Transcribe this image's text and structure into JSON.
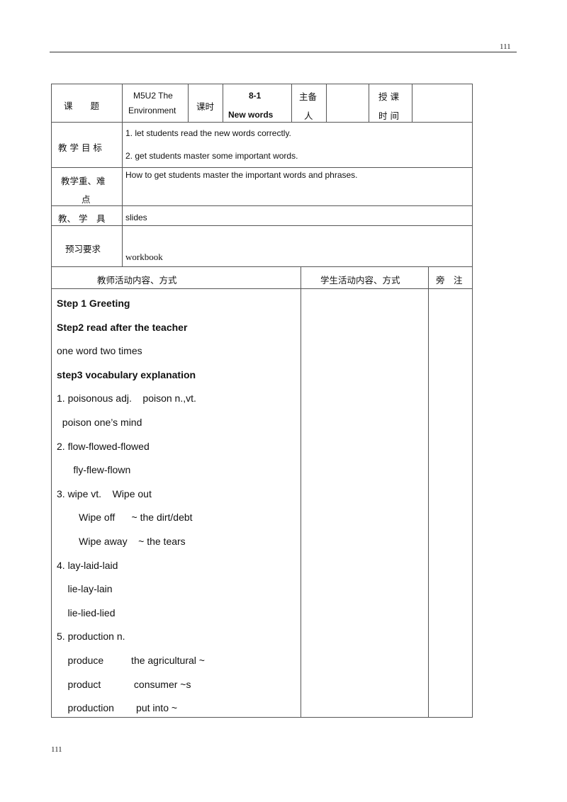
{
  "header": {
    "page_number": "111"
  },
  "footer": {
    "page_number": "111"
  },
  "info_row": {
    "topic_label": "课　　题",
    "topic_value_line1": "M5U2 The",
    "topic_value_line2": "Environment",
    "period_label": "课时",
    "period_value_line1": "8-1",
    "period_value_line2": "New words",
    "preparer_label_line1": "主备",
    "preparer_label_line2": "人",
    "preparer_value": "",
    "time_label_line1": "授 课",
    "time_label_line2": "时 间",
    "time_value": ""
  },
  "objectives": {
    "label": "教 学 目 标",
    "items": [
      "1. let students read the new words correctly.",
      "2. get students master some important words."
    ]
  },
  "key_points": {
    "label_line1": "教学重、难",
    "label_line2": "点",
    "value": "How to get students master the important words and phrases."
  },
  "tools": {
    "label": "教、 学　具",
    "value": "slides"
  },
  "preview": {
    "label": "预习要求",
    "value": "workbook"
  },
  "activity_header": {
    "teacher": "教师活动内容、方式",
    "student": "学生活动内容、方式",
    "notes": "旁　注"
  },
  "teacher_activities": [
    {
      "text": "Step 1 Greeting",
      "bold": true
    },
    {
      "text": "Step2 read after the teacher",
      "bold": true
    },
    {
      "text": "one word two times",
      "bold": false
    },
    {
      "text": "step3 vocabulary explanation",
      "bold": true
    },
    {
      "text": "1. poisonous adj.    poison n.,vt.",
      "bold": false
    },
    {
      "text": "  poison one’s mind",
      "bold": false
    },
    {
      "text": "2. flow-flowed-flowed",
      "bold": false
    },
    {
      "text": "      fly-flew-flown",
      "bold": false
    },
    {
      "text": "3. wipe vt.    Wipe out",
      "bold": false
    },
    {
      "text": "        Wipe off      ~ the dirt/debt",
      "bold": false
    },
    {
      "text": "        Wipe away    ~ the tears",
      "bold": false
    },
    {
      "text": "4. lay-laid-laid",
      "bold": false
    },
    {
      "text": "    lie-lay-lain",
      "bold": false
    },
    {
      "text": "    lie-lied-lied",
      "bold": false
    },
    {
      "text": "5. production n.",
      "bold": false
    },
    {
      "text": "    produce          the agricultural ~",
      "bold": false
    },
    {
      "text": "    product            consumer ~s",
      "bold": false
    },
    {
      "text": "    production        put into ~",
      "bold": false
    }
  ],
  "student_activities": "",
  "notes": ""
}
